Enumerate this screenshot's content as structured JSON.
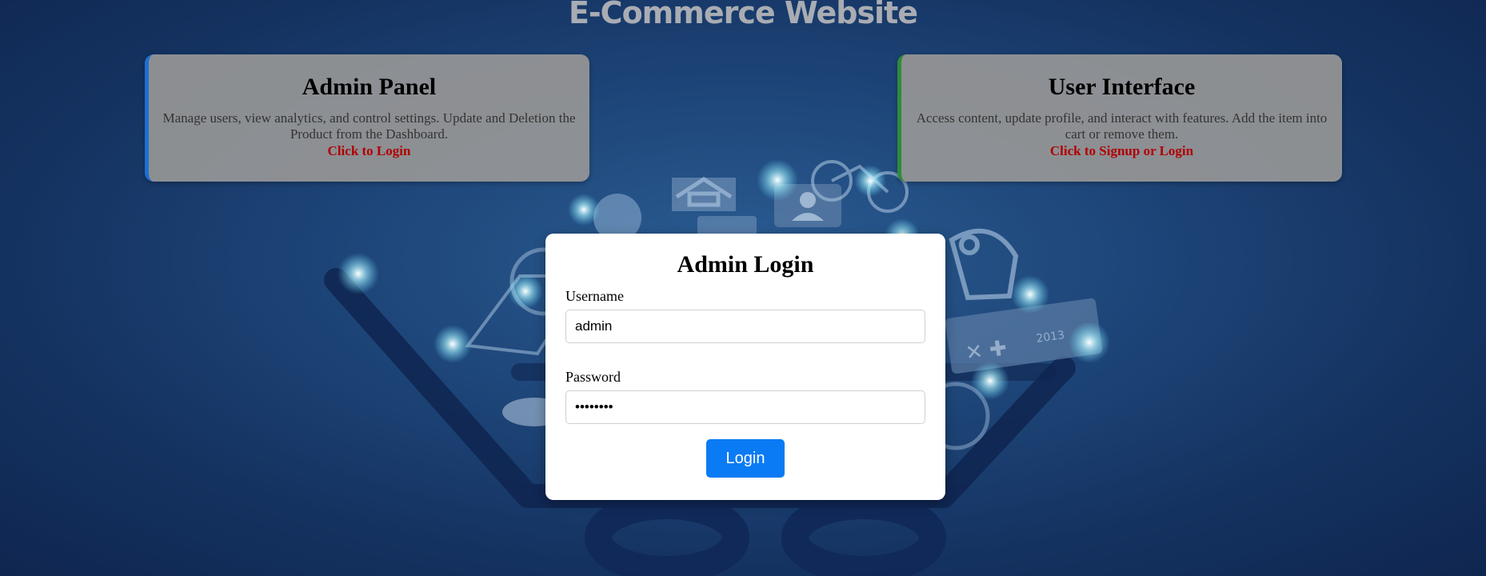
{
  "site": {
    "title": "E-Commerce Website"
  },
  "admin_card": {
    "title": "Admin Panel",
    "description": "Manage users, view analytics, and control settings. Update and Deletion the Product from the Dashboard.",
    "link": "Click to Login",
    "accent_color": "#1f6fd1"
  },
  "user_card": {
    "title": "User Interface",
    "description": "Access content, update profile, and interact with features. Add the item into cart or remove them.",
    "link": "Click to Signup or Login",
    "accent_color": "#2e8b3a"
  },
  "login_form": {
    "title": "Admin Login",
    "username_label": "Username",
    "username_value": "admin",
    "password_label": "Password",
    "password_value": "admin123",
    "submit_label": "Login",
    "button_color": "#0a7bf5"
  },
  "background": {
    "calculator_text": "2013"
  }
}
